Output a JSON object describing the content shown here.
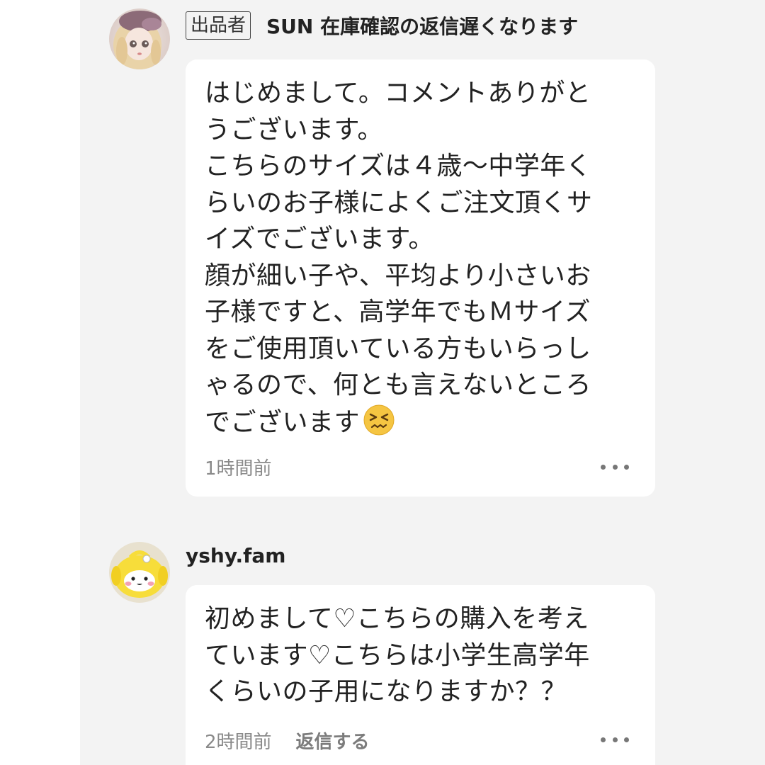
{
  "comments": [
    {
      "seller_badge": "出品者",
      "user_name": "SUN 在庫確認の返信遅くなります",
      "body_lines": [
        "はじめまして。コメントありがと",
        "うございます。",
        "こちらのサイズは４歳〜中学年く",
        "らいのお子様によくご注文頂くサ",
        "イズでございます。",
        "顔が細い子や、平均より小さいお",
        "子様ですと、高学年でもＭサイズ",
        "をご使用頂いている方もいらっし",
        "ゃるので、何とも言えないところ",
        "でございます"
      ],
      "emoji": "confounded-face",
      "time": "1時間前",
      "more_label": "..."
    },
    {
      "user_name": "yshy.fam",
      "body_lines": [
        "初めまして♡こちらの購入を考え",
        "ています♡こちらは小学生高学年",
        "くらいの子用になりますか？？"
      ],
      "time": "2時間前",
      "reply_label": "返信する",
      "more_label": "..."
    }
  ],
  "colors": {
    "background": "#f3f3f3",
    "bubble": "#ffffff",
    "text": "#222222",
    "muted": "#8a8a8a"
  }
}
